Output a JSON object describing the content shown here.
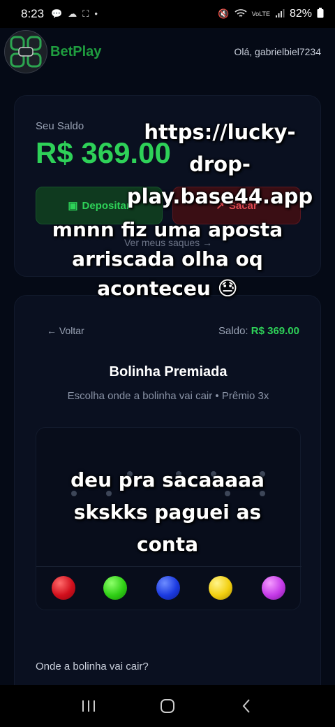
{
  "status_bar": {
    "time": "8:23",
    "battery": "82%"
  },
  "header": {
    "brand": "BetPlay",
    "greeting": "Olá, gabrielbiel7234"
  },
  "balance_card": {
    "label": "Seu Saldo",
    "value": "R$ 369.00",
    "deposit_label": "Depositar",
    "withdraw_label": "Sacar",
    "view_withdrawals": "Ver meus saques →"
  },
  "game": {
    "back": "← Voltar",
    "saldo_label": "Saldo:",
    "saldo_value": "R$ 369.00",
    "title": "Bolinha Premiada",
    "subtitle": "Escolha onde a bolinha vai cair • Prêmio 3x",
    "choose_label": "Onde a bolinha vai cair?",
    "balls": [
      "red",
      "green",
      "blue",
      "yellow",
      "purple"
    ]
  },
  "overlay": {
    "url": "https://lucky-drop-play.base44.app",
    "caption1": "mnnn fiz uma aposta arriscada olha oq aconteceu 😓",
    "caption2": "deu pra sacaaaaa skskks paguei as conta"
  },
  "colors": {
    "accent_green": "#2ed158",
    "accent_red": "#e04a52",
    "background": "#050a16"
  }
}
